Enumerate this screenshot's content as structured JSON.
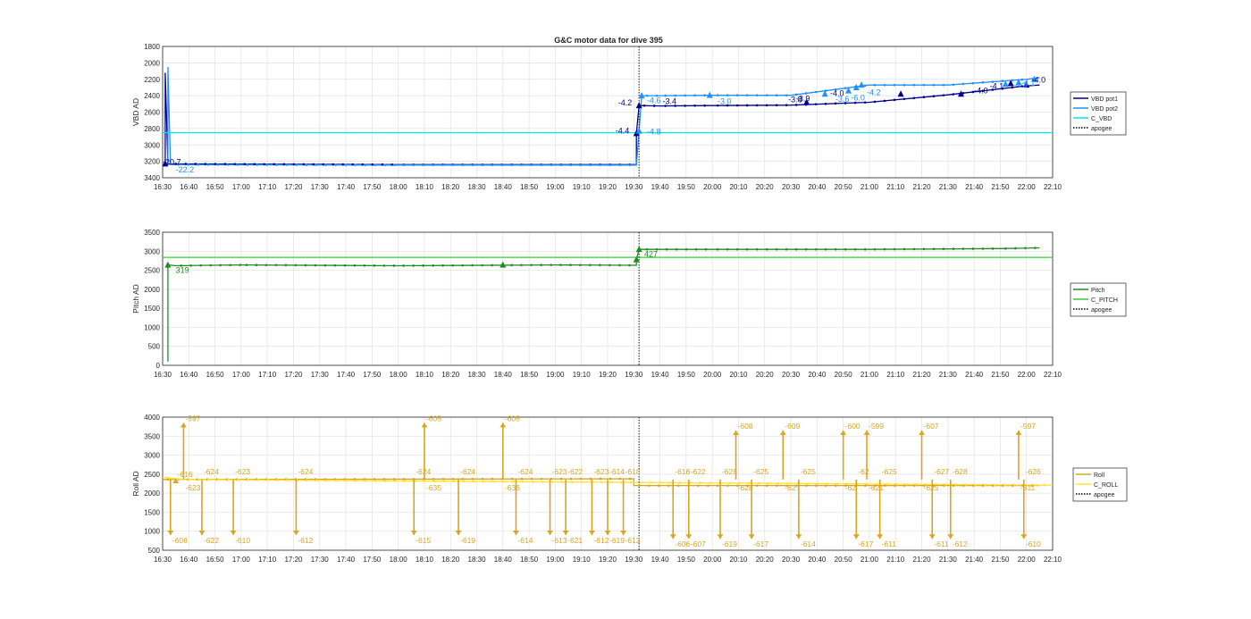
{
  "figure": {
    "title": "G&C motor data for dive 395"
  },
  "colors": {
    "vbd_pot1": "#00008B",
    "vbd_pot2": "#1E90FF",
    "c_vbd": "#00E5EE",
    "pitch": "#228B22",
    "c_pitch": "#32CD32",
    "roll": "#DAA520",
    "c_roll": "#FFE135",
    "apogee": "#000000",
    "grid": "#e2e2e2",
    "axis": "#262626"
  },
  "chart_data": [
    {
      "type": "line",
      "title": "G&C motor data for dive 395",
      "ylabel": "VBD AD",
      "y_reversed": true,
      "ylim": [
        1800,
        3400
      ],
      "yticks": [
        1800,
        2000,
        2200,
        2400,
        2600,
        2800,
        3000,
        3200,
        3400
      ],
      "xlim": [
        "16:30",
        "22:10"
      ],
      "xticks": [
        "16:30",
        "16:40",
        "16:50",
        "17:00",
        "17:10",
        "17:20",
        "17:30",
        "17:40",
        "17:50",
        "18:00",
        "18:10",
        "18:20",
        "18:30",
        "18:40",
        "18:50",
        "19:00",
        "19:10",
        "19:20",
        "19:30",
        "19:40",
        "19:50",
        "20:00",
        "20:10",
        "20:20",
        "20:30",
        "20:40",
        "20:50",
        "21:00",
        "21:10",
        "21:20",
        "21:30",
        "21:40",
        "21:50",
        "22:00",
        "22:10"
      ],
      "grid": true,
      "legend_position": "right",
      "series": [
        {
          "name": "VBD pot1",
          "style": "line",
          "color_key": "vbd_pot1",
          "x": [
            "16:31",
            "16:31",
            "16:32",
            "16:33",
            "16:33",
            "16:33",
            "18:00",
            "19:31",
            "19:31",
            "19:32",
            "19:40",
            "20:00",
            "20:30",
            "21:00",
            "21:30",
            "22:00",
            "22:05"
          ],
          "y": [
            3230,
            2120,
            3230,
            3230,
            3245,
            3230,
            3240,
            3240,
            2860,
            2520,
            2525,
            2520,
            2515,
            2480,
            2390,
            2280,
            2270
          ]
        },
        {
          "name": "VBD pot2",
          "style": "line",
          "color_key": "vbd_pot2",
          "x": [
            "16:32",
            "16:32",
            "16:33",
            "16:34",
            "18:00",
            "19:31",
            "19:32",
            "19:33",
            "19:40",
            "20:00",
            "20:30",
            "21:00",
            "21:30",
            "22:00",
            "22:05"
          ],
          "y": [
            3230,
            2050,
            3230,
            3240,
            3245,
            3245,
            2830,
            2400,
            2400,
            2395,
            2395,
            2270,
            2270,
            2200,
            2180
          ]
        },
        {
          "name": "C_VBD",
          "style": "line",
          "color_key": "c_vbd",
          "x": [
            "16:30",
            "22:10"
          ],
          "y": [
            2850,
            2850
          ]
        },
        {
          "name": "apogee",
          "style": "dotted-vertical",
          "color_key": "apogee",
          "x": [
            "19:32"
          ]
        }
      ],
      "markers": [
        {
          "x": "16:31",
          "y": 3230,
          "color_key": "vbd_pot1"
        },
        {
          "x": "19:31",
          "y": 2860,
          "color_key": "vbd_pot1"
        },
        {
          "x": "19:32",
          "y": 2520,
          "color_key": "vbd_pot1"
        },
        {
          "x": "19:32",
          "y": 2830,
          "color_key": "vbd_pot2"
        },
        {
          "x": "19:33",
          "y": 2400,
          "color_key": "vbd_pot2"
        },
        {
          "x": "19:59",
          "y": 2395,
          "color_key": "vbd_pot2"
        },
        {
          "x": "20:36",
          "y": 2480,
          "color_key": "vbd_pot1"
        },
        {
          "x": "20:43",
          "y": 2380,
          "color_key": "vbd_pot2"
        },
        {
          "x": "20:52",
          "y": 2340,
          "color_key": "vbd_pot2"
        },
        {
          "x": "20:55",
          "y": 2300,
          "color_key": "vbd_pot2"
        },
        {
          "x": "20:57",
          "y": 2270,
          "color_key": "vbd_pot2"
        },
        {
          "x": "21:12",
          "y": 2380,
          "color_key": "vbd_pot1"
        },
        {
          "x": "21:35",
          "y": 2380,
          "color_key": "vbd_pot1"
        },
        {
          "x": "21:52",
          "y": 2260,
          "color_key": "vbd_pot2"
        },
        {
          "x": "21:54",
          "y": 2250,
          "color_key": "vbd_pot1"
        },
        {
          "x": "21:57",
          "y": 2240,
          "color_key": "vbd_pot2"
        },
        {
          "x": "22:00",
          "y": 2270,
          "color_key": "vbd_pot1"
        },
        {
          "x": "22:03",
          "y": 2200,
          "color_key": "vbd_pot2"
        }
      ],
      "annotations": [
        {
          "text": "-20.7",
          "x": "16:30",
          "y": 3240,
          "color_key": "vbd_pot1"
        },
        {
          "text": "-22.2",
          "x": "16:35",
          "y": 3335,
          "color_key": "vbd_pot2"
        },
        {
          "text": "-4.2",
          "x": "19:24",
          "y": 2520,
          "color_key": "vbd_pot1"
        },
        {
          "text": "-4.4",
          "x": "19:23",
          "y": 2860,
          "color_key": "vbd_pot1"
        },
        {
          "text": "-4.6",
          "x": "19:35",
          "y": 2490,
          "color_key": "vbd_pot2"
        },
        {
          "text": "-4.8",
          "x": "19:35",
          "y": 2870,
          "color_key": "vbd_pot2"
        },
        {
          "text": "-3.4",
          "x": "19:41",
          "y": 2500,
          "color_key": "vbd_pot1"
        },
        {
          "text": "-3.0",
          "x": "20:02",
          "y": 2500,
          "color_key": "vbd_pot2"
        },
        {
          "text": "-3.8",
          "x": "20:29",
          "y": 2480,
          "color_key": "vbd_pot1"
        },
        {
          "text": "-3.9",
          "x": "20:32",
          "y": 2470,
          "color_key": "vbd_pot1"
        },
        {
          "text": "-4.0",
          "x": "20:45",
          "y": 2405,
          "color_key": "vbd_pot1"
        },
        {
          "text": "-3.6",
          "x": "20:47",
          "y": 2475,
          "color_key": "vbd_pot2"
        },
        {
          "text": "-6.0",
          "x": "20:53",
          "y": 2460,
          "color_key": "vbd_pot2"
        },
        {
          "text": "-4.2",
          "x": "20:59",
          "y": 2395,
          "color_key": "vbd_pot2"
        },
        {
          "text": "-4.0",
          "x": "21:40",
          "y": 2370,
          "color_key": "vbd_pot1"
        },
        {
          "text": "-4.1",
          "x": "21:46",
          "y": 2315,
          "color_key": "vbd_pot1"
        },
        {
          "text": "-4.3",
          "x": "21:55",
          "y": 2300,
          "color_key": "vbd_pot2"
        },
        {
          "text": "-4.1",
          "x": "21:58",
          "y": 2280,
          "color_key": "vbd_pot2"
        },
        {
          "text": "-4.0",
          "x": "22:02",
          "y": 2240,
          "color_key": "vbd_pot1"
        }
      ]
    },
    {
      "type": "line",
      "ylabel": "Pitch AD",
      "ylim": [
        0,
        3500
      ],
      "yticks": [
        0,
        500,
        1000,
        1500,
        2000,
        2500,
        3000,
        3500
      ],
      "xlim": [
        "16:30",
        "22:10"
      ],
      "xticks": [
        "16:30",
        "16:40",
        "16:50",
        "17:00",
        "17:10",
        "17:20",
        "17:30",
        "17:40",
        "17:50",
        "18:00",
        "18:10",
        "18:20",
        "18:30",
        "18:40",
        "18:50",
        "19:00",
        "19:10",
        "19:20",
        "19:30",
        "19:40",
        "19:50",
        "20:00",
        "20:10",
        "20:20",
        "20:30",
        "20:40",
        "20:50",
        "21:00",
        "21:10",
        "21:20",
        "21:30",
        "21:40",
        "21:50",
        "22:00",
        "22:10"
      ],
      "grid": true,
      "legend_position": "right",
      "series": [
        {
          "name": "Pitch",
          "style": "line",
          "color_key": "pitch",
          "x": [
            "16:32",
            "16:32",
            "16:35",
            "17:00",
            "18:00",
            "19:00",
            "19:31",
            "19:31",
            "19:32",
            "19:33",
            "20:00",
            "21:00",
            "21:50",
            "22:05"
          ],
          "y": [
            100,
            2640,
            2620,
            2640,
            2620,
            2640,
            2630,
            2780,
            3050,
            3050,
            3050,
            3050,
            3070,
            3090
          ]
        },
        {
          "name": "C_PITCH",
          "style": "line",
          "color_key": "c_pitch",
          "x": [
            "16:30",
            "22:10"
          ],
          "y": [
            2840,
            2840
          ]
        },
        {
          "name": "apogee",
          "style": "dotted-vertical",
          "color_key": "apogee",
          "x": [
            "19:32"
          ]
        }
      ],
      "markers": [
        {
          "x": "16:32",
          "y": 2640,
          "color_key": "pitch"
        },
        {
          "x": "18:40",
          "y": 2640,
          "color_key": "pitch"
        },
        {
          "x": "19:31",
          "y": 2780,
          "color_key": "pitch"
        },
        {
          "x": "19:32",
          "y": 3050,
          "color_key": "pitch"
        }
      ],
      "annotations": [
        {
          "text": "319",
          "x": "16:35",
          "y": 2430,
          "color_key": "pitch"
        },
        {
          "text": "427",
          "x": "19:34",
          "y": 2850,
          "color_key": "pitch"
        }
      ]
    },
    {
      "type": "line",
      "ylabel": "Roll AD",
      "ylim": [
        500,
        4000
      ],
      "yticks": [
        500,
        1000,
        1500,
        2000,
        2500,
        3000,
        3500,
        4000
      ],
      "xlim": [
        "16:30",
        "22:10"
      ],
      "xticks": [
        "16:30",
        "16:40",
        "16:50",
        "17:00",
        "17:10",
        "17:20",
        "17:30",
        "17:40",
        "17:50",
        "18:00",
        "18:10",
        "18:20",
        "18:30",
        "18:40",
        "18:50",
        "19:00",
        "19:10",
        "19:20",
        "19:30",
        "19:40",
        "19:50",
        "20:00",
        "20:10",
        "20:20",
        "20:30",
        "20:40",
        "20:50",
        "21:00",
        "21:10",
        "21:20",
        "21:30",
        "21:40",
        "21:50",
        "22:00",
        "22:10"
      ],
      "grid": true,
      "legend_position": "right",
      "series": [
        {
          "name": "Roll",
          "style": "line",
          "color_key": "roll",
          "x": [
            "16:30",
            "19:30",
            "19:30",
            "22:05"
          ],
          "y": [
            2360,
            2380,
            2200,
            2200
          ]
        },
        {
          "name": "C_ROLL",
          "style": "line",
          "color_key": "c_roll",
          "x": [
            "16:30",
            "16:38",
            "22:10"
          ],
          "y": [
            2420,
            2360,
            2210
          ]
        },
        {
          "name": "apogee",
          "style": "dotted-vertical",
          "color_key": "apogee",
          "x": [
            "19:32"
          ]
        }
      ],
      "roll_maneuvers": [
        {
          "x": "16:33",
          "peak": 900,
          "lbl_top": "",
          "lbl_bot": "-608"
        },
        {
          "x": "16:35",
          "peak": 2380,
          "lbl_top": "-616",
          "lbl_bot": ""
        },
        {
          "x": "16:38",
          "peak": 3850,
          "lbl_top": "-597",
          "lbl_bot": "-623"
        },
        {
          "x": "16:45",
          "peak": 900,
          "lbl_top": "-624",
          "lbl_bot": "-622"
        },
        {
          "x": "16:57",
          "peak": 900,
          "lbl_top": "-623",
          "lbl_bot": "-610"
        },
        {
          "x": "17:21",
          "peak": 900,
          "lbl_top": "-624",
          "lbl_bot": "-612"
        },
        {
          "x": "18:06",
          "peak": 900,
          "lbl_top": "-624",
          "lbl_bot": "-615"
        },
        {
          "x": "18:10",
          "peak": 3850,
          "lbl_top": "-605",
          "lbl_bot": "-635"
        },
        {
          "x": "18:23",
          "peak": 900,
          "lbl_top": "-624",
          "lbl_bot": "-619"
        },
        {
          "x": "18:40",
          "peak": 3850,
          "lbl_top": "-605",
          "lbl_bot": "-636"
        },
        {
          "x": "18:45",
          "peak": 900,
          "lbl_top": "-624",
          "lbl_bot": "-614"
        },
        {
          "x": "18:58",
          "peak": 900,
          "lbl_top": "-623",
          "lbl_bot": "-613"
        },
        {
          "x": "19:04",
          "peak": 900,
          "lbl_top": "-622",
          "lbl_bot": "-621"
        },
        {
          "x": "19:14",
          "peak": 900,
          "lbl_top": "-623",
          "lbl_bot": "-612"
        },
        {
          "x": "19:20",
          "peak": 900,
          "lbl_top": "-614",
          "lbl_bot": "-619"
        },
        {
          "x": "19:26",
          "peak": 900,
          "lbl_top": "-618",
          "lbl_bot": "-612"
        },
        {
          "x": "19:45",
          "peak": 800,
          "lbl_top": "-616",
          "lbl_bot": "-606"
        },
        {
          "x": "19:51",
          "peak": 800,
          "lbl_top": "-622",
          "lbl_bot": "-607"
        },
        {
          "x": "20:03",
          "peak": 800,
          "lbl_top": "-628",
          "lbl_bot": "-619"
        },
        {
          "x": "20:09",
          "peak": 3650,
          "lbl_top": "-608",
          "lbl_bot": "-628"
        },
        {
          "x": "20:15",
          "peak": 800,
          "lbl_top": "-625",
          "lbl_bot": "-617"
        },
        {
          "x": "20:27",
          "peak": 3650,
          "lbl_top": "-609",
          "lbl_bot": "-62"
        },
        {
          "x": "20:33",
          "peak": 800,
          "lbl_top": "-625",
          "lbl_bot": "-614"
        },
        {
          "x": "20:50",
          "peak": 3650,
          "lbl_top": "-600",
          "lbl_bot": "-62"
        },
        {
          "x": "20:55",
          "peak": 800,
          "lbl_top": "-62",
          "lbl_bot": "-617"
        },
        {
          "x": "20:59",
          "peak": 3650,
          "lbl_top": "-599",
          "lbl_bot": "-621"
        },
        {
          "x": "21:04",
          "peak": 800,
          "lbl_top": "-625",
          "lbl_bot": "-611"
        },
        {
          "x": "21:20",
          "peak": 3650,
          "lbl_top": "-607",
          "lbl_bot": "-625"
        },
        {
          "x": "21:24",
          "peak": 800,
          "lbl_top": "-627",
          "lbl_bot": "-611"
        },
        {
          "x": "21:31",
          "peak": 800,
          "lbl_top": "-628",
          "lbl_bot": "-612"
        },
        {
          "x": "21:57",
          "peak": 3650,
          "lbl_top": "-597",
          "lbl_bot": "-611"
        },
        {
          "x": "21:59",
          "peak": 800,
          "lbl_top": "-626",
          "lbl_bot": "-610"
        }
      ]
    }
  ]
}
